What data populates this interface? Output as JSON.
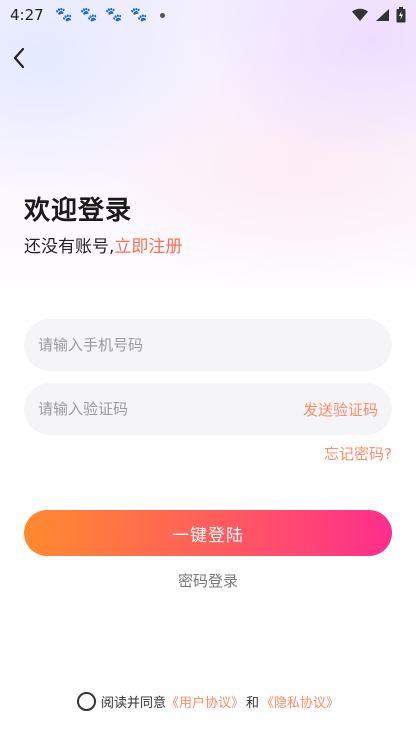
{
  "status_bar": {
    "time": "4:27"
  },
  "login": {
    "title": "欢迎登录",
    "no_account_text": "还没有账号,",
    "register_link": "立即注册",
    "phone_placeholder": "请输入手机号码",
    "code_placeholder": "请输入验证码",
    "send_code_label": "发送验证码",
    "forgot_password_label": "忘记密码?",
    "login_button_label": "一键登陆",
    "password_login_label": "密码登录"
  },
  "agreement": {
    "prefix": "阅读并同意",
    "user_agreement_link": "《用户协议》",
    "and_text": "和",
    "privacy_link": "《隐私协议》"
  },
  "colors": {
    "accent": "#ff6d55",
    "button_gradient_start": "#ff8a2e",
    "button_gradient_end": "#ff2d8e"
  }
}
